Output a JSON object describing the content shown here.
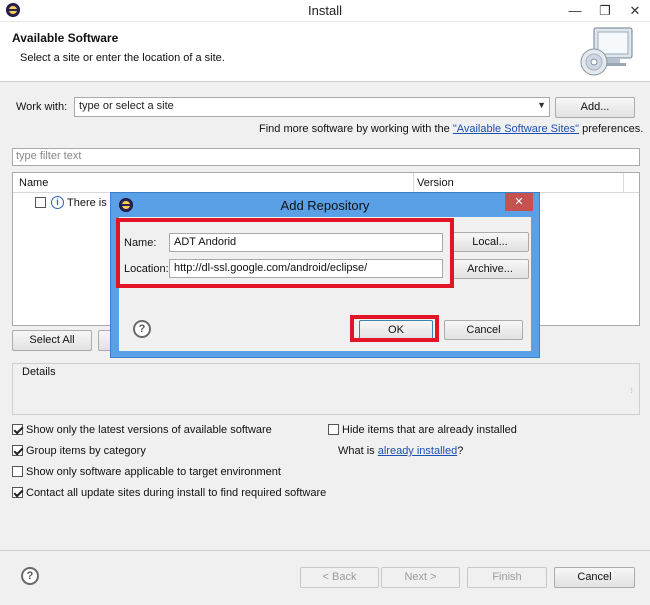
{
  "window": {
    "title": "Install",
    "minimize_glyph": "—",
    "restore_glyph": "❐",
    "close_glyph": "✕"
  },
  "header": {
    "title": "Available Software",
    "subtitle": "Select a site or enter the location of a site."
  },
  "work_with": {
    "label": "Work with:",
    "placeholder": "type or select a site",
    "add_button": "Add...",
    "hint_prefix": "Find more software by working with the ",
    "hint_link": "\"Available Software Sites\"",
    "hint_suffix": " preferences."
  },
  "filter": {
    "placeholder": "type filter text"
  },
  "tree": {
    "columns": [
      "Name",
      "Version"
    ],
    "row_text": "There is n"
  },
  "buttons": {
    "select_all": "Select All"
  },
  "details": {
    "label": "Details"
  },
  "options": {
    "latest_only": {
      "label": "Show only the latest versions of available software",
      "checked": true
    },
    "group_by_category": {
      "label": "Group items by category",
      "checked": true
    },
    "target_env": {
      "label": "Show only software applicable to target environment",
      "checked": false
    },
    "contact_sites": {
      "label": "Contact all update sites during install to find required software",
      "checked": true
    },
    "hide_installed": {
      "label": "Hide items that are already installed",
      "checked": false
    },
    "what_is_prefix": "What is ",
    "what_is_link": "already installed",
    "what_is_suffix": "?"
  },
  "footer": {
    "back": "< Back",
    "next": "Next >",
    "finish": "Finish",
    "cancel": "Cancel"
  },
  "dialog": {
    "title": "Add Repository",
    "close_glyph": "✕",
    "name_label": "Name:",
    "name_value": "ADT Andorid",
    "location_label": "Location:",
    "location_value": "http://dl-ssl.google.com/android/eclipse/",
    "local_button": "Local...",
    "archive_button": "Archive...",
    "ok_button": "OK",
    "cancel_button": "Cancel"
  },
  "colors": {
    "highlight": "#e21526",
    "dialog_frame": "#5aa0e6",
    "link": "#1a4fb4"
  }
}
